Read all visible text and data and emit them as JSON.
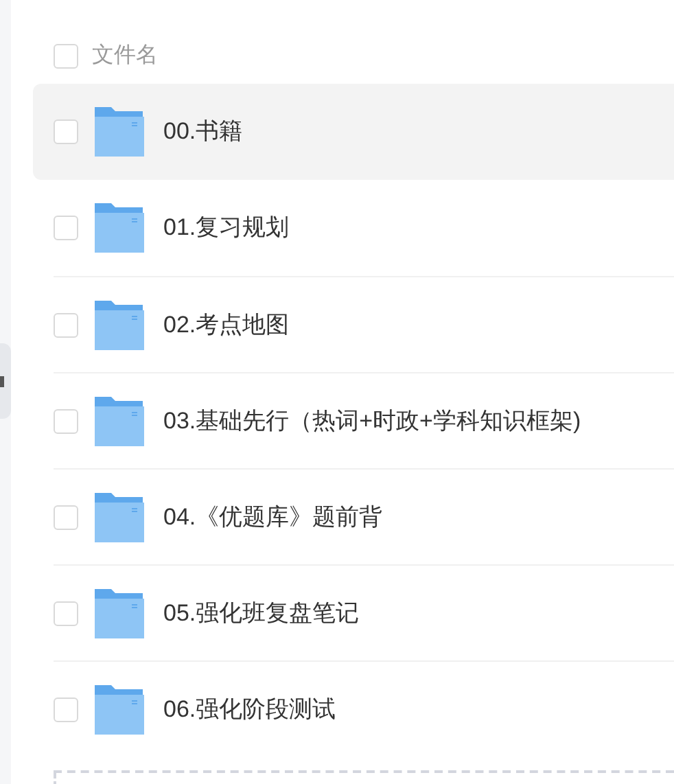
{
  "header": {
    "label": "文件名",
    "checked": false
  },
  "files": [
    {
      "name": "00.书籍",
      "highlighted": true,
      "checked": false
    },
    {
      "name": "01.复习规划",
      "highlighted": false,
      "checked": false
    },
    {
      "name": "02.考点地图",
      "highlighted": false,
      "checked": false
    },
    {
      "name": "03.基础先行（热词+时政+学科知识框架)",
      "highlighted": false,
      "checked": false
    },
    {
      "name": "04.《优题库》题前背",
      "highlighted": false,
      "checked": false
    },
    {
      "name": "05.强化班复盘笔记",
      "highlighted": false,
      "checked": false
    },
    {
      "name": "06.强化阶段测试",
      "highlighted": false,
      "checked": false
    }
  ]
}
